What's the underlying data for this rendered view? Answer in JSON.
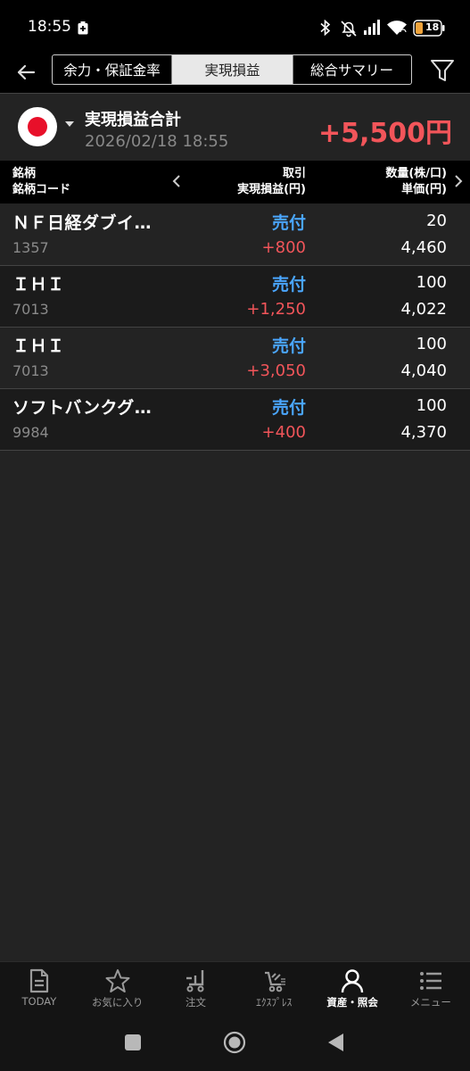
{
  "status_bar": {
    "time": "18:55",
    "battery_level": "18",
    "icons": [
      "battery-saver-icon",
      "bluetooth-icon",
      "silent-icon",
      "signal-icon",
      "wifi-icon",
      "battery-icon"
    ]
  },
  "header": {
    "tabs": [
      {
        "label": "余力・保証金率",
        "active": false
      },
      {
        "label": "実現損益",
        "active": true
      },
      {
        "label": "総合サマリー",
        "active": false
      }
    ],
    "back_icon": "back-arrow-icon",
    "filter_icon": "filter-icon"
  },
  "summary": {
    "market_flag": "japan-flag-icon",
    "title": "実現損益合計",
    "date": "2026/02/18  18:55",
    "total": "+5,500円"
  },
  "columns": {
    "col1_line1": "銘柄",
    "col1_line2": "銘柄コード",
    "col2_line1": "取引",
    "col2_line2": "実現損益(円)",
    "col3_line1": "数量(株/口)",
    "col3_line2": "単価(円)"
  },
  "rows": [
    {
      "name": "ＮＦ日経ダブイ…",
      "code": "1357",
      "trade": "売付",
      "pl": "+800",
      "qty": "20",
      "price": "4,460"
    },
    {
      "name": "ＩＨＩ",
      "code": "7013",
      "trade": "売付",
      "pl": "+1,250",
      "qty": "100",
      "price": "4,022"
    },
    {
      "name": "ＩＨＩ",
      "code": "7013",
      "trade": "売付",
      "pl": "+3,050",
      "qty": "100",
      "price": "4,040"
    },
    {
      "name": "ソフトバンクグ…",
      "code": "9984",
      "trade": "売付",
      "pl": "+400",
      "qty": "100",
      "price": "4,370"
    }
  ],
  "bottom_nav": [
    {
      "label": "TODAY",
      "icon": "today-icon",
      "active": false
    },
    {
      "label": "お気に入り",
      "icon": "star-icon",
      "active": false
    },
    {
      "label": "注文",
      "icon": "order-cart-icon",
      "active": false
    },
    {
      "label": "ｴｸｽﾌﾟﾚｽ",
      "icon": "express-cart-icon",
      "active": false
    },
    {
      "label": "資産・照会",
      "icon": "person-icon",
      "active": true
    },
    {
      "label": "メニュー",
      "icon": "menu-icon",
      "active": false
    }
  ],
  "colors": {
    "positive": "#f2555a",
    "trade_sell": "#4aa6ff",
    "background": "#232323",
    "header_bg": "#000000"
  }
}
